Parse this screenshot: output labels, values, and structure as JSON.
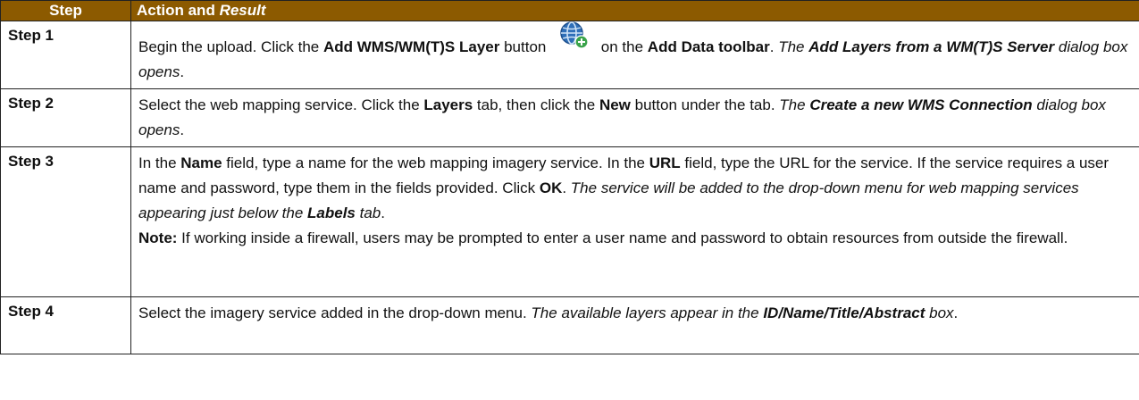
{
  "header": {
    "step": "Step",
    "action": "Action and ",
    "result": "Result"
  },
  "rows": [
    {
      "step": "Step 1",
      "segments": [
        {
          "t": "Begin the upload. Click the ",
          "b": false,
          "i": false
        },
        {
          "t": "Add WMS/WM(T)S Layer",
          "b": true,
          "i": false
        },
        {
          "t": " button ",
          "b": false,
          "i": false
        },
        {
          "icon": "add-wms-layer-icon"
        },
        {
          "t": " on the ",
          "b": false,
          "i": false
        },
        {
          "t": "Add Data toolbar",
          "b": true,
          "i": false
        },
        {
          "t": ". ",
          "b": false,
          "i": false
        },
        {
          "t": "The ",
          "b": false,
          "i": true
        },
        {
          "t": "Add Layers from a WM(T)S Server",
          "b": true,
          "i": true
        },
        {
          "t": " dialog box opens",
          "b": false,
          "i": true
        },
        {
          "t": ".",
          "b": false,
          "i": false
        }
      ]
    },
    {
      "step": "Step 2",
      "segments": [
        {
          "t": "Select the web mapping service. Click the ",
          "b": false,
          "i": false
        },
        {
          "t": "Layers",
          "b": true,
          "i": false
        },
        {
          "t": " tab, then click the ",
          "b": false,
          "i": false
        },
        {
          "t": "New",
          "b": true,
          "i": false
        },
        {
          "t": " button under the tab. ",
          "b": false,
          "i": false
        },
        {
          "t": "The ",
          "b": false,
          "i": true
        },
        {
          "t": "Create a new WMS Connection",
          "b": true,
          "i": true
        },
        {
          "t": " dialog box opens",
          "b": false,
          "i": true
        },
        {
          "t": ".",
          "b": false,
          "i": false
        }
      ]
    },
    {
      "step": "Step 3",
      "segments": [
        {
          "t": "In the ",
          "b": false,
          "i": false
        },
        {
          "t": "Name",
          "b": true,
          "i": false
        },
        {
          "t": " field, type a name for the web mapping imagery service. In the ",
          "b": false,
          "i": false
        },
        {
          "t": "URL",
          "b": true,
          "i": false
        },
        {
          "t": " field, type the URL for the service. If the service requires a user name and password, type them in the fields provided. Click ",
          "b": false,
          "i": false
        },
        {
          "t": "OK",
          "b": true,
          "i": false
        },
        {
          "t": ". ",
          "b": false,
          "i": false
        },
        {
          "t": "The service will be added to the drop-down menu for web mapping services appearing just below the ",
          "b": false,
          "i": true
        },
        {
          "t": "Labels",
          "b": true,
          "i": true
        },
        {
          "t": " tab",
          "b": false,
          "i": true
        },
        {
          "t": ".",
          "b": false,
          "i": false
        },
        {
          "br": true
        },
        {
          "t": "Note:",
          "b": true,
          "i": false
        },
        {
          "t": " If working inside a firewall, users may be prompted to enter a user name and password to obtain resources from outside the firewall.",
          "b": false,
          "i": false
        }
      ]
    },
    {
      "step": "Step 4",
      "segments": [
        {
          "t": "Select the imagery service added in the drop-down menu. ",
          "b": false,
          "i": false
        },
        {
          "t": "The available layers appear in the ",
          "b": false,
          "i": true
        },
        {
          "t": "ID/Name/Title/Abstract",
          "b": true,
          "i": true
        },
        {
          "t": " box",
          "b": false,
          "i": true
        },
        {
          "t": ".",
          "b": false,
          "i": false
        }
      ]
    }
  ]
}
